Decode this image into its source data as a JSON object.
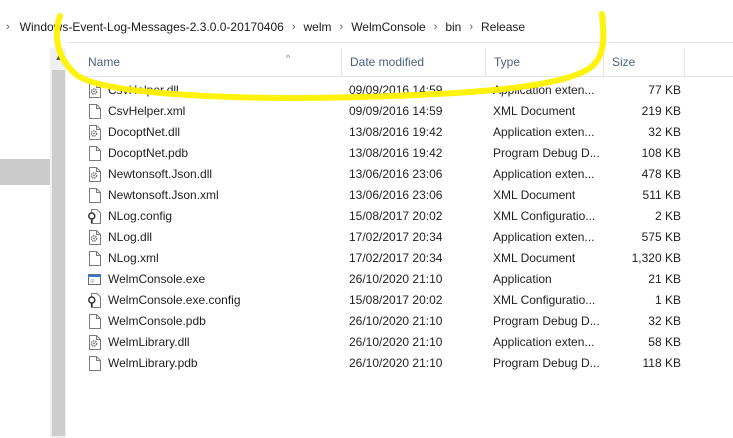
{
  "breadcrumb": {
    "items": [
      "Windows-Event-Log-Messages-2.3.0.0-20170406",
      "welm",
      "WelmConsole",
      "bin",
      "Release"
    ]
  },
  "columns": {
    "name": "Name",
    "date": "Date modified",
    "type": "Type",
    "size": "Size"
  },
  "files": [
    {
      "name": "CsvHelper.dll",
      "date": "09/09/2016 14:59",
      "type": "Application exten...",
      "size": "77 KB",
      "icon": "dll-gear-icon"
    },
    {
      "name": "CsvHelper.xml",
      "date": "09/09/2016 14:59",
      "type": "XML Document",
      "size": "219 KB",
      "icon": "document-icon"
    },
    {
      "name": "DocoptNet.dll",
      "date": "13/08/2016 19:42",
      "type": "Application exten...",
      "size": "32 KB",
      "icon": "dll-gear-icon"
    },
    {
      "name": "DocoptNet.pdb",
      "date": "13/08/2016 19:42",
      "type": "Program Debug D...",
      "size": "108 KB",
      "icon": "document-icon"
    },
    {
      "name": "Newtonsoft.Json.dll",
      "date": "13/06/2016 23:06",
      "type": "Application exten...",
      "size": "478 KB",
      "icon": "dll-gear-icon"
    },
    {
      "name": "Newtonsoft.Json.xml",
      "date": "13/06/2016 23:06",
      "type": "XML Document",
      "size": "511 KB",
      "icon": "document-icon"
    },
    {
      "name": "NLog.config",
      "date": "15/08/2017 20:02",
      "type": "XML Configuratio...",
      "size": "2 KB",
      "icon": "config-icon"
    },
    {
      "name": "NLog.dll",
      "date": "17/02/2017 20:34",
      "type": "Application exten...",
      "size": "575 KB",
      "icon": "dll-gear-icon"
    },
    {
      "name": "NLog.xml",
      "date": "17/02/2017 20:34",
      "type": "XML Document",
      "size": "1,320 KB",
      "icon": "document-icon"
    },
    {
      "name": "WelmConsole.exe",
      "date": "26/10/2020 21:10",
      "type": "Application",
      "size": "21 KB",
      "icon": "exe-icon"
    },
    {
      "name": "WelmConsole.exe.config",
      "date": "15/08/2017 20:02",
      "type": "XML Configuratio...",
      "size": "1 KB",
      "icon": "config-icon"
    },
    {
      "name": "WelmConsole.pdb",
      "date": "26/10/2020 21:10",
      "type": "Program Debug D...",
      "size": "32 KB",
      "icon": "document-icon"
    },
    {
      "name": "WelmLibrary.dll",
      "date": "26/10/2020 21:10",
      "type": "Application exten...",
      "size": "58 KB",
      "icon": "dll-gear-icon"
    },
    {
      "name": "WelmLibrary.pdb",
      "date": "26/10/2020 21:10",
      "type": "Program Debug D...",
      "size": "118 KB",
      "icon": "document-icon"
    }
  ],
  "colors": {
    "annotation": "#fff200",
    "header_text": "#4c607a"
  }
}
